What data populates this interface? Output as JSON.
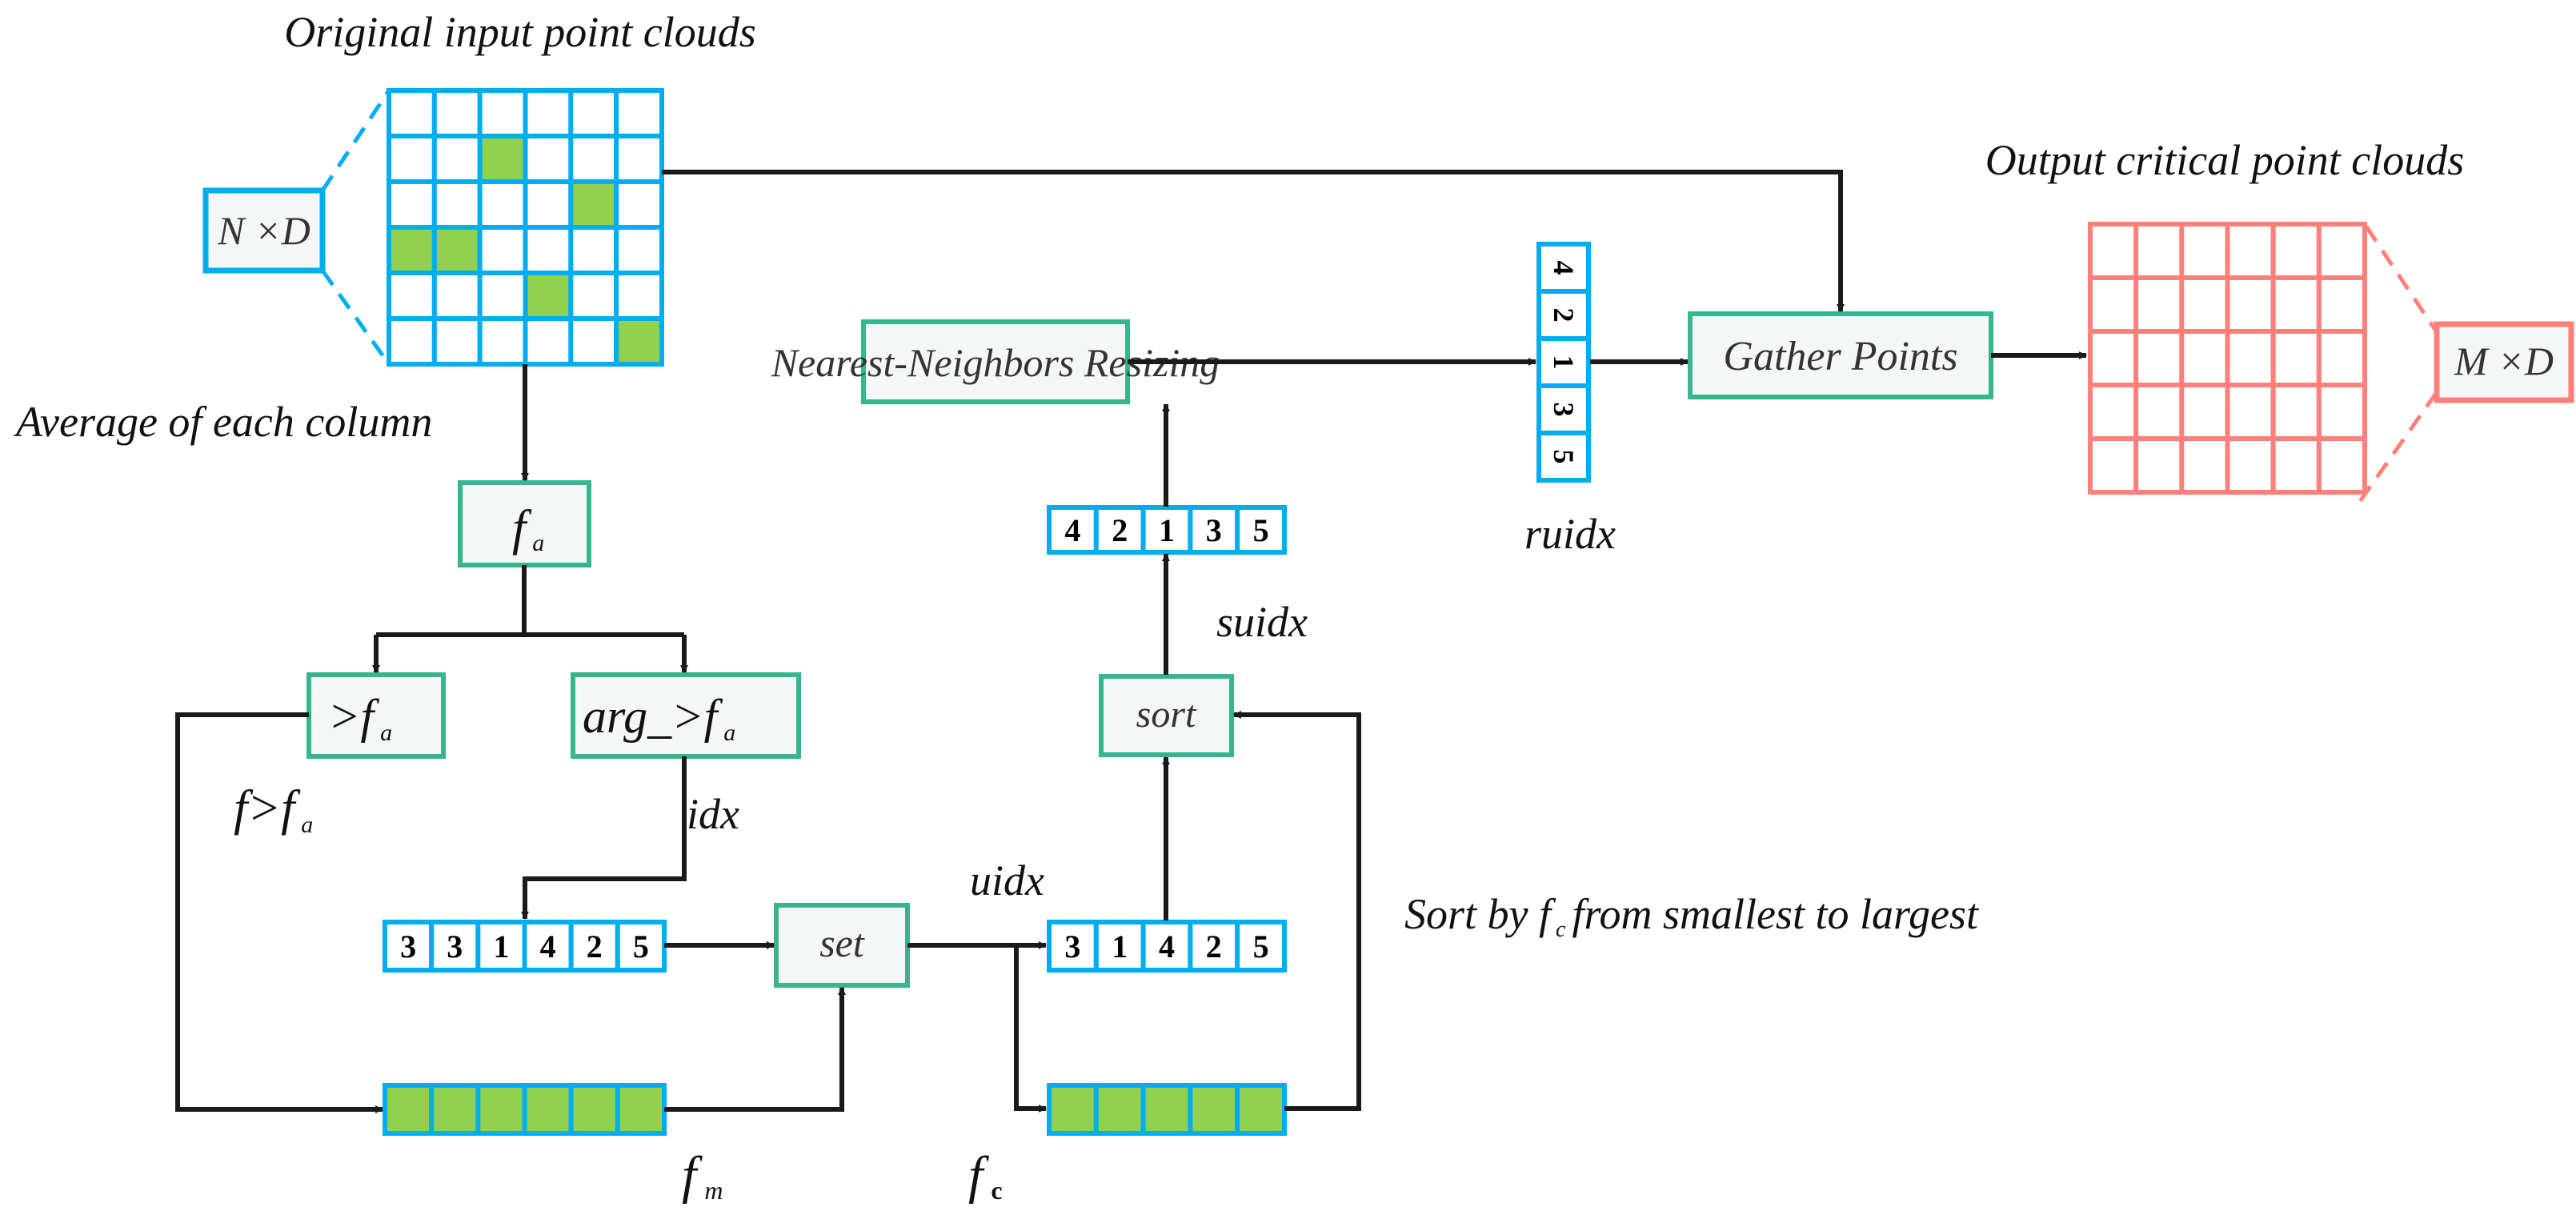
{
  "colors": {
    "blue": "#00AEEF",
    "green_fill": "#92D050",
    "teal": "#36B58F",
    "salmon": "#FF7F7B",
    "box_fill": "#F4F7F6",
    "arrow": "#1A1A1A"
  },
  "labels": {
    "input_title": "Original input point clouds",
    "output_title": "Output critical point clouds",
    "average": "Average of each column",
    "f_gt_fa": "f>f",
    "f_gt_fa_sub": "a",
    "idx": "idx",
    "uidx": "uidx",
    "suidx": "suidx",
    "ruidx": "ruidx",
    "fm": "f",
    "fm_sub": "m",
    "fc": "f",
    "fc_sub": "c",
    "sort_note_pre": "Sort by f",
    "sort_note_sub": "c",
    "sort_note_post": "from smallest to largest"
  },
  "boxes": {
    "n_by_d": "N ×D",
    "m_by_d": "M ×D",
    "fa": "f",
    "fa_sub": "a",
    "gt_fa": ">f",
    "gt_fa_sub": "a",
    "arg_gt_fa": "arg_>f",
    "arg_gt_fa_sub": "a",
    "set": "set",
    "sort": "sort",
    "nn_resizing": "Nearest-Neighbors Resizing",
    "gather_points": "Gather Points"
  },
  "input_grid": {
    "rows": 6,
    "cols": 6,
    "highlighted": [
      [
        1,
        2
      ],
      [
        2,
        4
      ],
      [
        3,
        0
      ],
      [
        3,
        1
      ],
      [
        4,
        3
      ],
      [
        5,
        5
      ]
    ]
  },
  "output_grid": {
    "rows": 5,
    "cols": 6
  },
  "arrays": {
    "idx": [
      "3",
      "3",
      "1",
      "4",
      "2",
      "5"
    ],
    "uidx": [
      "3",
      "1",
      "4",
      "2",
      "5"
    ],
    "suidx": [
      "4",
      "2",
      "1",
      "3",
      "5"
    ],
    "ruidx": [
      "4",
      "2",
      "1",
      "3",
      "5"
    ],
    "fm_count": 6,
    "fc_count": 5
  }
}
